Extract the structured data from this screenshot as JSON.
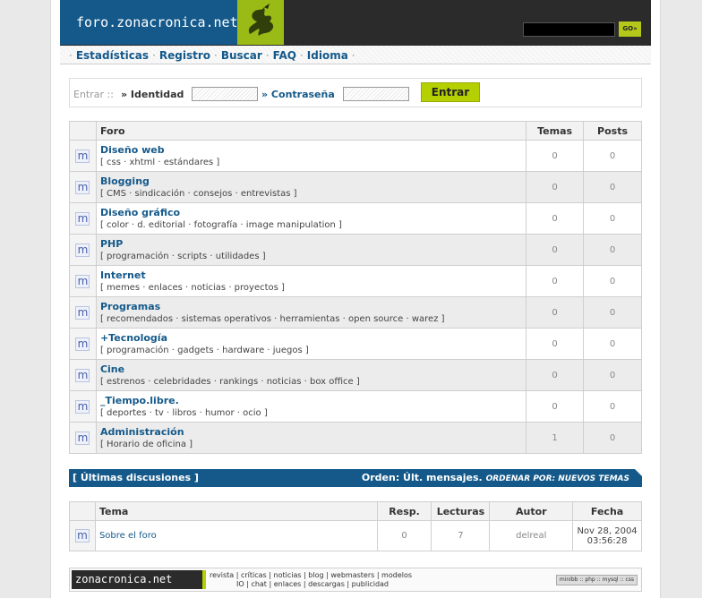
{
  "header": {
    "logo": "foro.zonacronica.net",
    "search_value": "",
    "go_label": "GO»"
  },
  "nav": {
    "items": [
      "Estadísticas",
      "Registro",
      "Buscar",
      "FAQ",
      "Idioma"
    ]
  },
  "login": {
    "entrar": "Entrar ::",
    "identidad": "» Identidad",
    "contrasena": "» Contraseña",
    "button": "Entrar"
  },
  "forums": {
    "headers": {
      "foro": "Foro",
      "temas": "Temas",
      "posts": "Posts"
    },
    "rows": [
      {
        "name": "Diseño web",
        "desc": "[ css · xhtml · estándares ]",
        "temas": "0",
        "posts": "0"
      },
      {
        "name": "Blogging",
        "desc": "[ CMS · sindicación · consejos · entrevistas ]",
        "temas": "0",
        "posts": "0"
      },
      {
        "name": "Diseño gráfico",
        "desc": "[ color · d. editorial · fotografía · image manipulation ]",
        "temas": "0",
        "posts": "0"
      },
      {
        "name": "PHP",
        "desc": "[ programación · scripts · utilidades ]",
        "temas": "0",
        "posts": "0"
      },
      {
        "name": "Internet",
        "desc": "[ memes · enlaces · noticias · proyectos ]",
        "temas": "0",
        "posts": "0"
      },
      {
        "name": "Programas",
        "desc": "[ recomendados · sistemas operativos · herramientas · open source · warez ]",
        "temas": "0",
        "posts": "0"
      },
      {
        "name": "+Tecnología",
        "desc": "[ programación · gadgets · hardware · juegos ]",
        "temas": "0",
        "posts": "0"
      },
      {
        "name": "Cine",
        "desc": "[ estrenos · celebridades · rankings · noticias · box office ]",
        "temas": "0",
        "posts": "0"
      },
      {
        "name": "_Tiempo.libre.",
        "desc": "[ deportes · tv · libros · humor · ocio ]",
        "temas": "0",
        "posts": "0"
      },
      {
        "name": "Administración",
        "desc": "[ Horario de oficina ]",
        "temas": "1",
        "posts": "0"
      }
    ]
  },
  "discussions": {
    "title": "[ Últimas discusiones ]",
    "order_label": "Orden: Últ. mensajes.",
    "order_link": "ORDENAR POR: NUEVOS TEMAS",
    "headers": {
      "tema": "Tema",
      "resp": "Resp.",
      "lecturas": "Lecturas",
      "autor": "Autor",
      "fecha": "Fecha"
    },
    "rows": [
      {
        "tema": "Sobre el foro",
        "resp": "0",
        "lecturas": "7",
        "autor": "delreal",
        "fecha1": "Nov 28, 2004",
        "fecha2": "03:56:28"
      }
    ]
  },
  "footer": {
    "logo": "zonacronica.net",
    "links_row1": "revista | críticas | noticias | blog | webmasters | modelos",
    "links_row2": "IO | chat | enlaces | descargas | publicidad",
    "tech": "minibb :: php :: mysql :: css"
  }
}
